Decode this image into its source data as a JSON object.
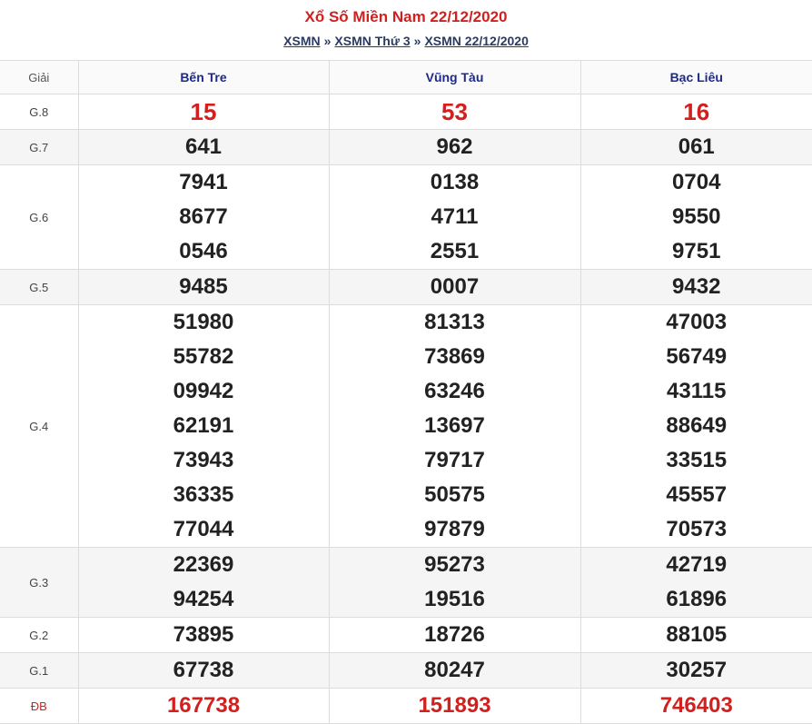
{
  "header": {
    "title": "Xổ Số Miền Nam 22/12/2020",
    "breadcrumb": [
      "XSMN",
      "XSMN Thứ 3",
      "XSMN 22/12/2020"
    ],
    "separator": "»"
  },
  "table": {
    "prize_col_label": "Giải",
    "provinces": [
      "Bến Tre",
      "Vũng Tàu",
      "Bạc Liêu"
    ],
    "rows": [
      {
        "prize": "G.8",
        "values": [
          [
            "15"
          ],
          [
            "53"
          ],
          [
            "16"
          ]
        ]
      },
      {
        "prize": "G.7",
        "values": [
          [
            "641"
          ],
          [
            "962"
          ],
          [
            "061"
          ]
        ]
      },
      {
        "prize": "G.6",
        "values": [
          [
            "7941",
            "8677",
            "0546"
          ],
          [
            "0138",
            "4711",
            "2551"
          ],
          [
            "0704",
            "9550",
            "9751"
          ]
        ]
      },
      {
        "prize": "G.5",
        "values": [
          [
            "9485"
          ],
          [
            "0007"
          ],
          [
            "9432"
          ]
        ]
      },
      {
        "prize": "G.4",
        "values": [
          [
            "51980",
            "55782",
            "09942",
            "62191",
            "73943",
            "36335",
            "77044"
          ],
          [
            "81313",
            "73869",
            "63246",
            "13697",
            "79717",
            "50575",
            "97879"
          ],
          [
            "47003",
            "56749",
            "43115",
            "88649",
            "33515",
            "45557",
            "70573"
          ]
        ]
      },
      {
        "prize": "G.3",
        "values": [
          [
            "22369",
            "94254"
          ],
          [
            "95273",
            "19516"
          ],
          [
            "42719",
            "61896"
          ]
        ]
      },
      {
        "prize": "G.2",
        "values": [
          [
            "73895"
          ],
          [
            "18726"
          ],
          [
            "88105"
          ]
        ]
      },
      {
        "prize": "G.1",
        "values": [
          [
            "67738"
          ],
          [
            "80247"
          ],
          [
            "30257"
          ]
        ]
      },
      {
        "prize": "ĐB",
        "values": [
          [
            "167738"
          ],
          [
            "151893"
          ],
          [
            "746403"
          ]
        ]
      }
    ]
  },
  "colors": {
    "title": "#d2201e",
    "breadcrumb": "#2a3b63",
    "province": "#1d2a8a",
    "highlight": "#d2201e"
  }
}
